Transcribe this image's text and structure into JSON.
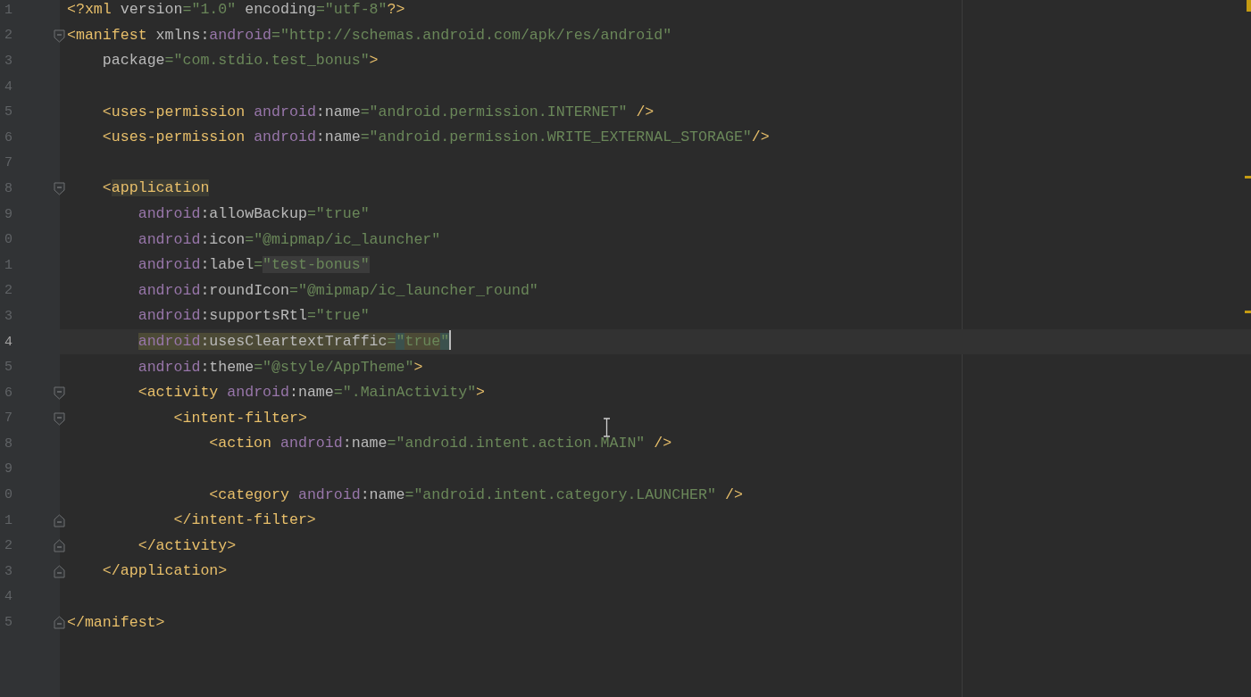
{
  "editor": {
    "lines": [
      {
        "number": "1",
        "current": false,
        "kind": "plain",
        "tokens": [
          {
            "kind": "tag",
            "text": "<?xml"
          },
          {
            "kind": "attr",
            "text": " version"
          },
          {
            "kind": "value",
            "text": "=\"1.0\""
          },
          {
            "kind": "attr",
            "text": " encoding"
          },
          {
            "kind": "value",
            "text": "=\"utf-8\""
          },
          {
            "kind": "tag",
            "text": "?>"
          }
        ]
      },
      {
        "number": "2",
        "current": false,
        "kind": "fold_start",
        "tokens": [
          {
            "kind": "tag",
            "text": "<manifest"
          },
          {
            "kind": "attr",
            "text": " xmlns:"
          },
          {
            "kind": "ns",
            "text": "android"
          },
          {
            "kind": "value",
            "text": "=\"http://schemas.android.com/apk/res/android\""
          }
        ]
      },
      {
        "number": "3",
        "current": false,
        "kind": "plain",
        "tokens": [
          {
            "kind": "attr",
            "text": "    package"
          },
          {
            "kind": "value",
            "text": "=\"com.stdio.test_bonus\""
          },
          {
            "kind": "tag",
            "text": ">"
          }
        ]
      },
      {
        "number": "4",
        "current": false,
        "kind": "plain"
      },
      {
        "number": "5",
        "current": false,
        "kind": "plain",
        "tokens": [
          {
            "kind": "tag",
            "text": "    <uses-permission"
          },
          {
            "kind": "ns",
            "text": " android"
          },
          {
            "kind": "attr",
            "text": ":name"
          },
          {
            "kind": "value",
            "text": "=\"android.permission.INTERNET\""
          },
          {
            "kind": "tag",
            "text": " />"
          }
        ]
      },
      {
        "number": "6",
        "current": false,
        "kind": "plain",
        "tokens": [
          {
            "kind": "tag",
            "text": "    <uses-permission"
          },
          {
            "kind": "ns",
            "text": " android"
          },
          {
            "kind": "attr",
            "text": ":name"
          },
          {
            "kind": "value",
            "text": "=\"android.permission.WRITE_EXTERNAL_STORAGE\""
          },
          {
            "kind": "tag",
            "text": "/>"
          }
        ]
      },
      {
        "number": "7",
        "current": false,
        "kind": "plain"
      },
      {
        "number": "8",
        "current": false,
        "kind": "fold_start",
        "tokens": [
          {
            "kind": "tag",
            "text": "    <"
          },
          {
            "kind": "matched_tag",
            "text": "application"
          }
        ]
      },
      {
        "number": "9",
        "current": false,
        "kind": "plain",
        "tokens": [
          {
            "kind": "ns",
            "text": "        android"
          },
          {
            "kind": "attr",
            "text": ":allowBackup"
          },
          {
            "kind": "value",
            "text": "=\"true\""
          }
        ]
      },
      {
        "number": "0",
        "current": false,
        "kind": "plain",
        "tokens": [
          {
            "kind": "ns",
            "text": "        android"
          },
          {
            "kind": "attr",
            "text": ":icon"
          },
          {
            "kind": "value",
            "text": "=\"@mipmap/ic_launcher\""
          }
        ]
      },
      {
        "number": "1",
        "current": false,
        "kind": "plain",
        "tokens": [
          {
            "kind": "ns",
            "text": "        android"
          },
          {
            "kind": "attr",
            "text": ":label"
          },
          {
            "kind": "value",
            "text": "="
          },
          {
            "kind": "usage_value",
            "text": "\"test-bonus\""
          }
        ]
      },
      {
        "number": "2",
        "current": false,
        "kind": "plain",
        "tokens": [
          {
            "kind": "ns",
            "text": "        android"
          },
          {
            "kind": "attr",
            "text": ":roundIcon"
          },
          {
            "kind": "value",
            "text": "=\"@mipmap/ic_launcher_round\""
          }
        ]
      },
      {
        "number": "3",
        "current": false,
        "kind": "plain",
        "tokens": [
          {
            "kind": "ns",
            "text": "        android"
          },
          {
            "kind": "attr",
            "text": ":supportsRtl"
          },
          {
            "kind": "value",
            "text": "=\"true\""
          }
        ]
      },
      {
        "number": "4",
        "current": true,
        "kind": "plain",
        "tokens": [
          {
            "kind": "selected_ns",
            "text": "        android"
          },
          {
            "kind": "selected_attr",
            "text": ":usesCleartextTraffic"
          },
          {
            "kind": "selected_value",
            "text": "="
          },
          {
            "kind": "brace",
            "text": "\""
          },
          {
            "kind": "selected_value",
            "text": "true"
          },
          {
            "kind": "brace",
            "text": "\""
          }
        ]
      },
      {
        "number": "5",
        "current": false,
        "kind": "plain",
        "tokens": [
          {
            "kind": "ns",
            "text": "        android"
          },
          {
            "kind": "attr",
            "text": ":theme"
          },
          {
            "kind": "value",
            "text": "=\"@style/AppTheme\""
          },
          {
            "kind": "tag",
            "text": ">"
          }
        ]
      },
      {
        "number": "6",
        "current": false,
        "kind": "fold_start",
        "tokens": [
          {
            "kind": "tag",
            "text": "        <activity"
          },
          {
            "kind": "ns",
            "text": " android"
          },
          {
            "kind": "attr",
            "text": ":name"
          },
          {
            "kind": "value",
            "text": "=\".MainActivity\""
          },
          {
            "kind": "tag",
            "text": ">"
          }
        ]
      },
      {
        "number": "7",
        "current": false,
        "kind": "fold_start",
        "tokens": [
          {
            "kind": "tag",
            "text": "            <intent-filter>"
          }
        ]
      },
      {
        "number": "8",
        "current": false,
        "kind": "plain",
        "tokens": [
          {
            "kind": "tag",
            "text": "                <action"
          },
          {
            "kind": "ns",
            "text": " android"
          },
          {
            "kind": "attr",
            "text": ":name"
          },
          {
            "kind": "value",
            "text": "=\"android.intent.action.MAIN\""
          },
          {
            "kind": "tag",
            "text": " />"
          }
        ]
      },
      {
        "number": "9",
        "current": false,
        "kind": "plain"
      },
      {
        "number": "0",
        "current": false,
        "kind": "plain",
        "tokens": [
          {
            "kind": "tag",
            "text": "                <category"
          },
          {
            "kind": "ns",
            "text": " android"
          },
          {
            "kind": "attr",
            "text": ":name"
          },
          {
            "kind": "value",
            "text": "=\"android.intent.category.LAUNCHER\""
          },
          {
            "kind": "tag",
            "text": " />"
          }
        ]
      },
      {
        "number": "1",
        "current": false,
        "kind": "fold_end",
        "tokens": [
          {
            "kind": "tag",
            "text": "            </intent-filter>"
          }
        ]
      },
      {
        "number": "2",
        "current": false,
        "kind": "fold_end",
        "tokens": [
          {
            "kind": "tag",
            "text": "        </activity>"
          }
        ]
      },
      {
        "number": "3",
        "current": false,
        "kind": "fold_end",
        "tokens": [
          {
            "kind": "tag",
            "text": "    </application>"
          }
        ]
      },
      {
        "number": "4",
        "current": false,
        "kind": "plain"
      },
      {
        "number": "5",
        "current": false,
        "kind": "fold_end",
        "tokens": [
          {
            "kind": "tag",
            "text": "</manifest>"
          }
        ]
      }
    ]
  }
}
